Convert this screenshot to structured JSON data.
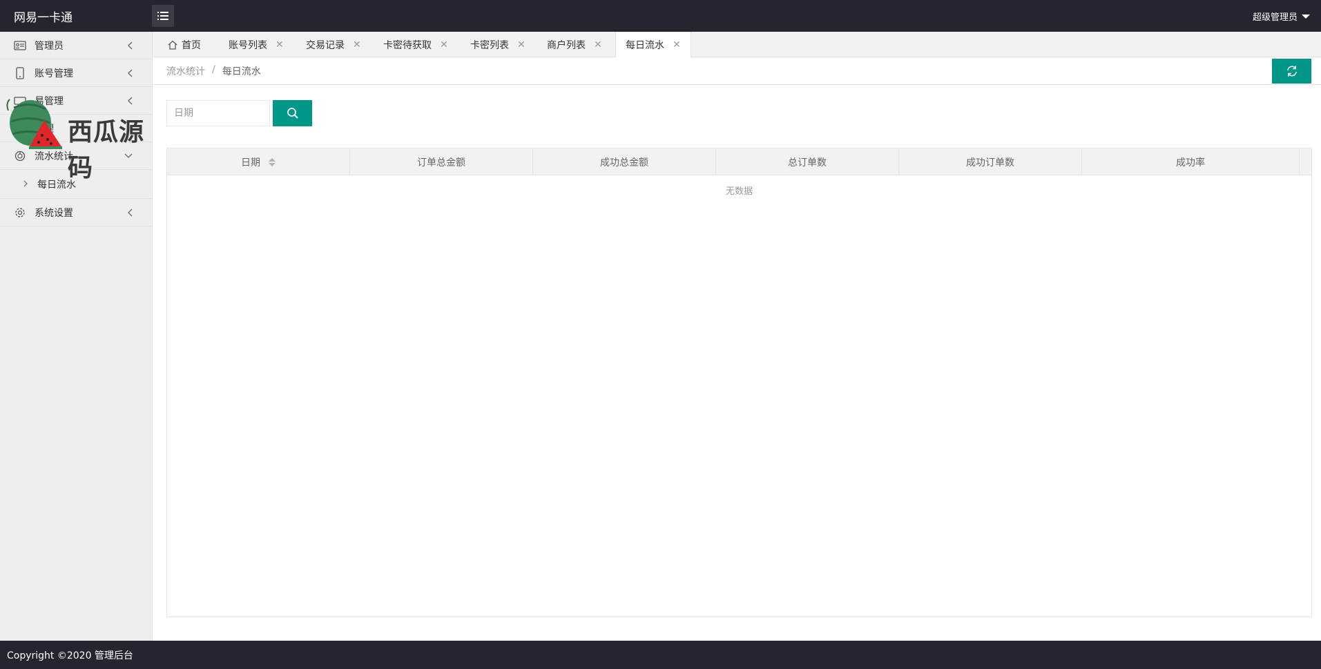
{
  "header": {
    "brand": "网易一卡通",
    "user": "超级管理员"
  },
  "sidebar": {
    "items": [
      {
        "label": "管理员"
      },
      {
        "label": "账号管理"
      },
      {
        "label": "易管理"
      },
      {
        "label": "管理"
      },
      {
        "label": "流水统计"
      },
      {
        "label": "系统设置"
      }
    ],
    "sub_items": [
      {
        "label": "每日流水"
      }
    ]
  },
  "watermark": {
    "text": "西瓜源码"
  },
  "tabs": [
    {
      "label": "首页"
    },
    {
      "label": "账号列表"
    },
    {
      "label": "交易记录"
    },
    {
      "label": "卡密待获取"
    },
    {
      "label": "卡密列表"
    },
    {
      "label": "商户列表"
    },
    {
      "label": "每日流水"
    }
  ],
  "breadcrumb": {
    "parent": "流水统计",
    "separator": "/",
    "current": "每日流水"
  },
  "search": {
    "date_placeholder": "日期"
  },
  "table": {
    "columns": [
      "日期",
      "订单总金额",
      "成功总金额",
      "总订单数",
      "成功订单数",
      "成功率"
    ],
    "empty_text": "无数据"
  },
  "footer": {
    "text": "Copyright ©2020 管理后台"
  },
  "colors": {
    "header_bg": "#23262e",
    "accent": "#009688",
    "sidebar_bg": "#eeeeee"
  }
}
